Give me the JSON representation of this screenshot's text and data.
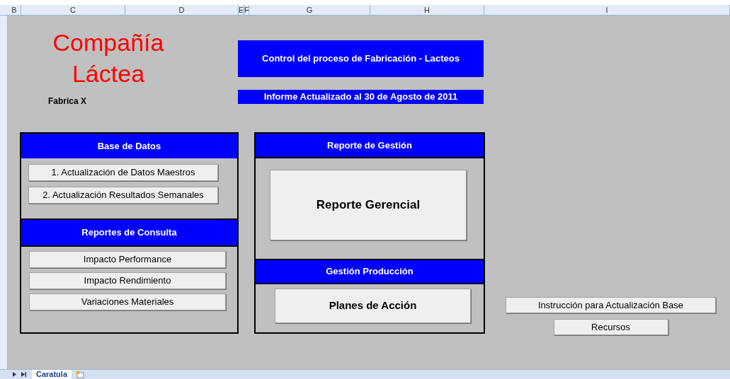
{
  "column_headers": [
    "B",
    "C",
    "D",
    "E",
    "F",
    "G",
    "H",
    "I"
  ],
  "company": {
    "title_line_1": "Compañía",
    "title_line_2": "Láctea",
    "plant": "Fabrica X"
  },
  "header": {
    "title": "Control del proceso de Fabricación - Lacteos",
    "report_date": "Informe Actualizado al 30 de Agosto de 2011"
  },
  "left_panel": {
    "sections": [
      {
        "heading": "Base de Datos",
        "buttons": [
          "1. Actualización de Datos Maestros",
          "2. Actualización Resultados Semanales"
        ]
      },
      {
        "heading": "Reportes de Consulta",
        "buttons": [
          "Impacto Performance",
          "Impacto  Rendimiento",
          "Variaciones Materiales"
        ]
      }
    ]
  },
  "middle_panel": {
    "sections": [
      {
        "heading": "Reporte de Gestión",
        "button": "Reporte Gerencial"
      },
      {
        "heading": "Gestión Producción",
        "button": "Planes de Acción"
      }
    ]
  },
  "side_buttons": [
    "Instrucción para Actualización Base",
    "Recursos"
  ],
  "sheet_tabs": [
    {
      "label": "Caratula",
      "selected": true
    }
  ]
}
